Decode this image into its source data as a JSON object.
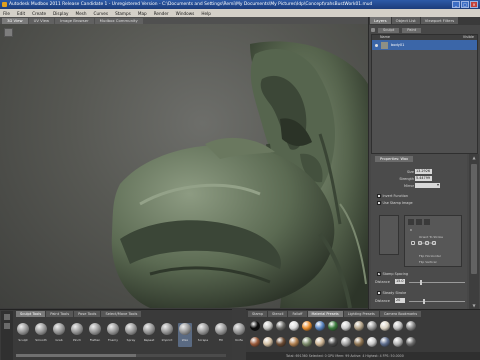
{
  "window": {
    "title": "Autodesk Mudbox 2011 Release Candidate 1 - Unregistered Version - C:\\Documents and Settings\\Remi\\My Documents\\My Pictures\\Idp\\Concept\\rahsBustWork01.mud",
    "minimize": "_",
    "maximize": "□",
    "close": "×"
  },
  "menubar": [
    "File",
    "Edit",
    "Create",
    "Display",
    "Mesh",
    "Curves",
    "Stamps",
    "Map",
    "Render",
    "Windows",
    "Help"
  ],
  "view_tabs": [
    {
      "label": "3D View",
      "active": true
    },
    {
      "label": "UV View",
      "active": false
    },
    {
      "label": "Image Browser",
      "active": false
    },
    {
      "label": "Mudbox Community",
      "active": false
    }
  ],
  "right_panel": {
    "tabs": [
      {
        "label": "Layers",
        "active": true
      },
      {
        "label": "Object List",
        "active": false
      },
      {
        "label": "Viewport Filters",
        "active": false
      }
    ],
    "toolbar": {
      "sculpt": "Sculpt",
      "paint": "Paint"
    },
    "layer_header": {
      "name": "Name",
      "visible": "Visible"
    },
    "layers": [
      {
        "name": "body01"
      }
    ],
    "properties": {
      "tab": "Properties: Wax",
      "size": {
        "label": "Size",
        "value": "13.2926"
      },
      "strength": {
        "label": "Strength",
        "value": "5.44799"
      },
      "mirror": {
        "label": "Mirror",
        "value": ""
      },
      "invert_function": {
        "label": "Invert Function",
        "checked": false
      },
      "use_stamp_image": {
        "label": "Use Stamp Image",
        "checked": false
      },
      "stamp": {
        "r": "R",
        "orient": "Orient To Stroke",
        "randomize": "Randomize",
        "flip": "Flip Horizontal",
        "flip_v": "Flip Vertical"
      },
      "stamp_spacing": {
        "label": "Stamp Spacing",
        "checked": true
      },
      "distance": {
        "label": "Distance",
        "value": "15.0",
        "fraction": 0.2
      },
      "steady_stroke": {
        "label": "Steady Stroke",
        "checked": false
      },
      "distance2": {
        "label": "Distance",
        "value": "20",
        "fraction": 0.25
      }
    }
  },
  "tool_tray": {
    "tabs": [
      {
        "label": "Sculpt Tools",
        "active": true
      },
      {
        "label": "Paint Tools",
        "active": false
      },
      {
        "label": "Pose Tools",
        "active": false
      },
      {
        "label": "Select/Move Tools",
        "active": false
      }
    ],
    "tools": [
      {
        "name": "Sculpt",
        "active": false
      },
      {
        "name": "Smooth",
        "active": false
      },
      {
        "name": "Grab",
        "active": false
      },
      {
        "name": "Pinch",
        "active": false
      },
      {
        "name": "Flatten",
        "active": false
      },
      {
        "name": "Foamy",
        "active": false
      },
      {
        "name": "Spray",
        "active": false
      },
      {
        "name": "Repeat",
        "active": false
      },
      {
        "name": "Imprint",
        "active": false
      },
      {
        "name": "Wax",
        "active": true
      },
      {
        "name": "Scrape",
        "active": false
      },
      {
        "name": "Fill",
        "active": false
      },
      {
        "name": "Knife",
        "active": false
      }
    ]
  },
  "material_tray": {
    "tabs": [
      {
        "label": "Stamp",
        "active": false
      },
      {
        "label": "Stencil",
        "active": false
      },
      {
        "label": "Falloff",
        "active": false
      },
      {
        "label": "Material Presets",
        "active": true
      },
      {
        "label": "Lighting Presets",
        "active": false
      },
      {
        "label": "Camera Bookmarks",
        "active": false
      }
    ],
    "row1_colors": [
      "#0b0b0b",
      "#c7c7c4",
      "#6f6f6c",
      "#dedede",
      "#ec9030",
      "#5a86c2",
      "#3a7a3c",
      "#cfcfcf",
      "#b4a48a",
      "#9a9a9a",
      "#dcd4c4",
      "#c2c2c2",
      "#8a8a8a"
    ],
    "row2_colors": [
      "#9a5a3a",
      "#d4c0a4",
      "#6a4a32",
      "#b08050",
      "#7a8a6a",
      "#ccb494",
      "#4a4a4a",
      "#a4a4a4",
      "#8e7452",
      "#c8c8c8",
      "#5c6c8c",
      "#b4b4b4",
      "#6c6c6c"
    ]
  },
  "status": "Total: 691360  Selected: 0  GPU Mem: 99  Active: 4  Highest: 4  FPS: 50.0000",
  "colors": {
    "sculpt_green": "#5b6b52",
    "selection_blue": "#3b66a8"
  }
}
